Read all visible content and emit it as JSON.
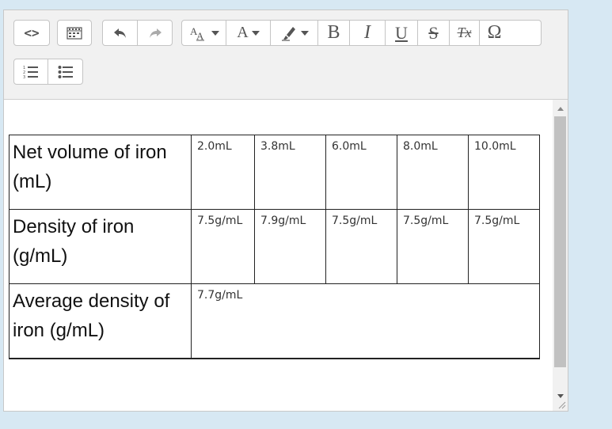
{
  "toolbar": {
    "buttons": [
      {
        "name": "source-code",
        "icon": "source-code-icon",
        "glyph": "<>"
      },
      {
        "name": "show-blocks",
        "icon": "show-blocks-icon"
      },
      {
        "name": "undo",
        "icon": "undo-icon"
      },
      {
        "name": "redo",
        "icon": "redo-icon"
      },
      {
        "name": "font-size",
        "icon": "font-size-icon"
      },
      {
        "name": "font-color",
        "icon": "font-color-icon",
        "glyph": "A"
      },
      {
        "name": "highlight",
        "icon": "highlight-icon"
      },
      {
        "name": "bold",
        "icon": "bold-icon",
        "glyph": "B"
      },
      {
        "name": "italic",
        "icon": "italic-icon",
        "glyph": "I"
      },
      {
        "name": "underline",
        "icon": "underline-icon",
        "glyph": "U"
      },
      {
        "name": "strikethrough",
        "icon": "strikethrough-icon",
        "glyph": "S"
      },
      {
        "name": "clear-formatting",
        "icon": "clear-formatting-icon",
        "glyph": "Tx"
      },
      {
        "name": "special-char",
        "icon": "omega-icon",
        "glyph": "Ω"
      },
      {
        "name": "numbered-list",
        "icon": "numbered-list-icon"
      },
      {
        "name": "bullet-list",
        "icon": "bullet-list-icon"
      }
    ]
  },
  "table": {
    "rows": [
      {
        "header": "Net volume of iron (mL)",
        "cells": [
          "2.0mL",
          "3.8mL",
          "6.0mL",
          "8.0mL",
          "10.0mL"
        ]
      },
      {
        "header": "Density of iron (g/mL)",
        "cells": [
          "7.5g/mL",
          "7.9g/mL",
          "7.5g/mL",
          "7.5g/mL",
          "7.5g/mL"
        ]
      },
      {
        "header": "Average density of iron (g/mL)",
        "cells": [
          "7.7g/mL"
        ]
      }
    ]
  },
  "colors": {
    "page_bg": "#d7e8f3",
    "toolbar_bg": "#f1f1f1",
    "icon": "#555555",
    "scroll_thumb": "#c1c1c1"
  }
}
